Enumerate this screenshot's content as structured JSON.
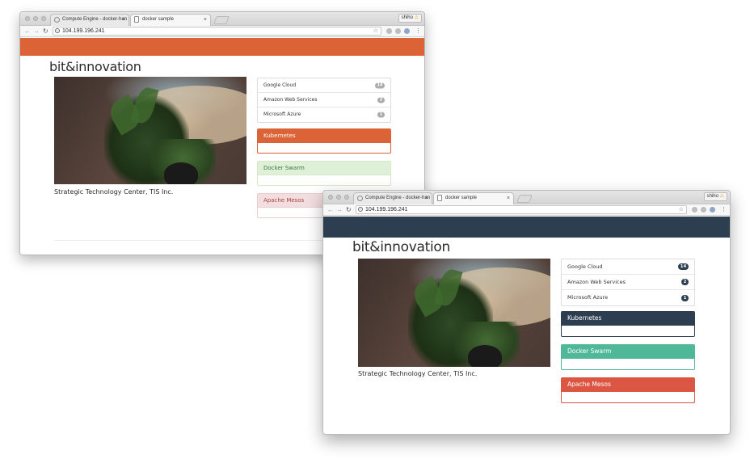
{
  "windows": [
    {
      "id": "win1",
      "tabs": [
        {
          "title": "Compute Engine - docker-han"
        },
        {
          "title": "docker sample"
        }
      ],
      "profile": {
        "name": "shiho",
        "warning": "⚠"
      },
      "url": "104.199.196.241",
      "banner_color": "#dc6336",
      "logo": "bit&innovation",
      "caption": "Strategic Technology Center, TIS Inc.",
      "badge_color": "#aaaaaa",
      "list": [
        {
          "label": "Google Cloud",
          "count": "14"
        },
        {
          "label": "Amazon Web Services",
          "count": "2"
        },
        {
          "label": "Microsoft Azure",
          "count": "1"
        }
      ],
      "panels": [
        {
          "title": "Kubernetes",
          "heading_bg": "#dc6336",
          "heading_fg": "#ffffff",
          "border": "#dc6336"
        },
        {
          "title": "Docker Swarm",
          "heading_bg": "#dff0d8",
          "heading_fg": "#3c763d",
          "border": "#d6e9c6"
        },
        {
          "title": "Apache Mesos",
          "heading_bg": "#f2dede",
          "heading_fg": "#a94442",
          "border": "#ebccd1"
        }
      ]
    },
    {
      "id": "win2",
      "tabs": [
        {
          "title": "Compute Engine - docker-han"
        },
        {
          "title": "docker sample"
        }
      ],
      "profile": {
        "name": "shiho",
        "warning": "⚠"
      },
      "url": "104.199.196.241",
      "banner_color": "#2c3e50",
      "logo": "bit&innovation",
      "caption": "Strategic Technology Center, TIS Inc.",
      "badge_color": "#2c3e50",
      "list": [
        {
          "label": "Google Cloud",
          "count": "14"
        },
        {
          "label": "Amazon Web Services",
          "count": "2"
        },
        {
          "label": "Microsoft Azure",
          "count": "1"
        }
      ],
      "panels": [
        {
          "title": "Kubernetes",
          "heading_bg": "#2c3e50",
          "heading_fg": "#ffffff",
          "border": "#2c3e50"
        },
        {
          "title": "Docker Swarm",
          "heading_bg": "#4eb898",
          "heading_fg": "#ffffff",
          "border": "#4eb898"
        },
        {
          "title": "Apache Mesos",
          "heading_bg": "#dc5644",
          "heading_fg": "#ffffff",
          "border": "#dc5644"
        }
      ]
    }
  ]
}
